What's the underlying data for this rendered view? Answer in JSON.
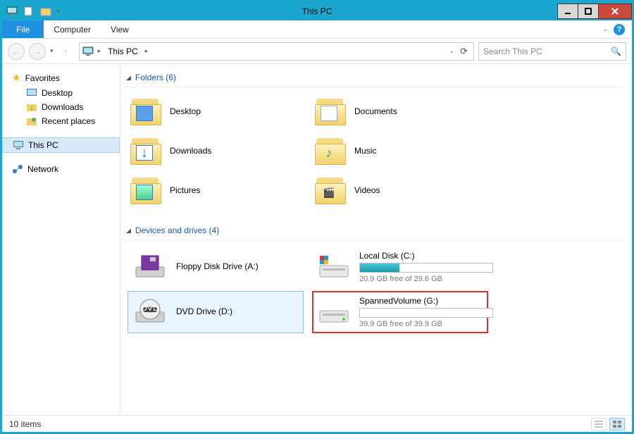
{
  "window": {
    "title": "This PC"
  },
  "menubar": {
    "file": "File",
    "computer": "Computer",
    "view": "View"
  },
  "breadcrumb": {
    "location": "This PC"
  },
  "search": {
    "placeholder": "Search This PC"
  },
  "sidebar": {
    "favorites": {
      "label": "Favorites",
      "items": [
        {
          "label": "Desktop"
        },
        {
          "label": "Downloads"
        },
        {
          "label": "Recent places"
        }
      ]
    },
    "thispc": {
      "label": "This PC"
    },
    "network": {
      "label": "Network"
    }
  },
  "sections": {
    "folders": {
      "header": "Folders (6)",
      "items": [
        {
          "label": "Desktop"
        },
        {
          "label": "Documents"
        },
        {
          "label": "Downloads"
        },
        {
          "label": "Music"
        },
        {
          "label": "Pictures"
        },
        {
          "label": "Videos"
        }
      ]
    },
    "drives": {
      "header": "Devices and drives (4)",
      "items": [
        {
          "label": "Floppy Disk Drive (A:)"
        },
        {
          "label": "Local Disk (C:)",
          "free": "20.9 GB free of 29.6 GB",
          "used_pct": 30
        },
        {
          "label": "DVD Drive (D:)"
        },
        {
          "label": "SpannedVolume (G:)",
          "free": "39.9 GB free of 39.9 GB",
          "used_pct": 0
        }
      ]
    }
  },
  "statusbar": {
    "count": "10 items"
  }
}
